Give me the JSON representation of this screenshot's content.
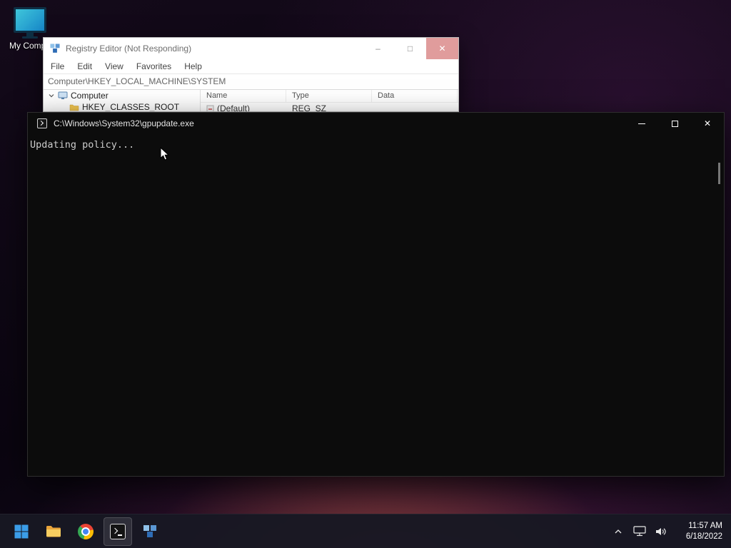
{
  "desktop": {
    "my_computer_label": "My Compu"
  },
  "registry_window": {
    "title": "Registry Editor (Not Responding)",
    "menu": [
      "File",
      "Edit",
      "View",
      "Favorites",
      "Help"
    ],
    "address": "Computer\\HKEY_LOCAL_MACHINE\\SYSTEM",
    "tree": {
      "root": "Computer",
      "child": "HKEY_CLASSES_ROOT"
    },
    "columns": [
      "Name",
      "Type",
      "Data"
    ],
    "list_row": {
      "name": "(Default)",
      "type": "REG_SZ"
    },
    "controls": {
      "minimize": "–",
      "maximize": "□",
      "close": "✕"
    }
  },
  "cmd_window": {
    "title": "C:\\Windows\\System32\\gpupdate.exe",
    "body_text": "Updating policy...",
    "controls": {
      "close": "✕"
    }
  },
  "taskbar": {
    "clock": {
      "time": "11:57 AM",
      "date": "6/18/2022"
    }
  },
  "colors": {
    "accent_blue": "#3b9de8",
    "close_hover_red": "#e09c9c",
    "console_bg": "#0c0c0c"
  }
}
